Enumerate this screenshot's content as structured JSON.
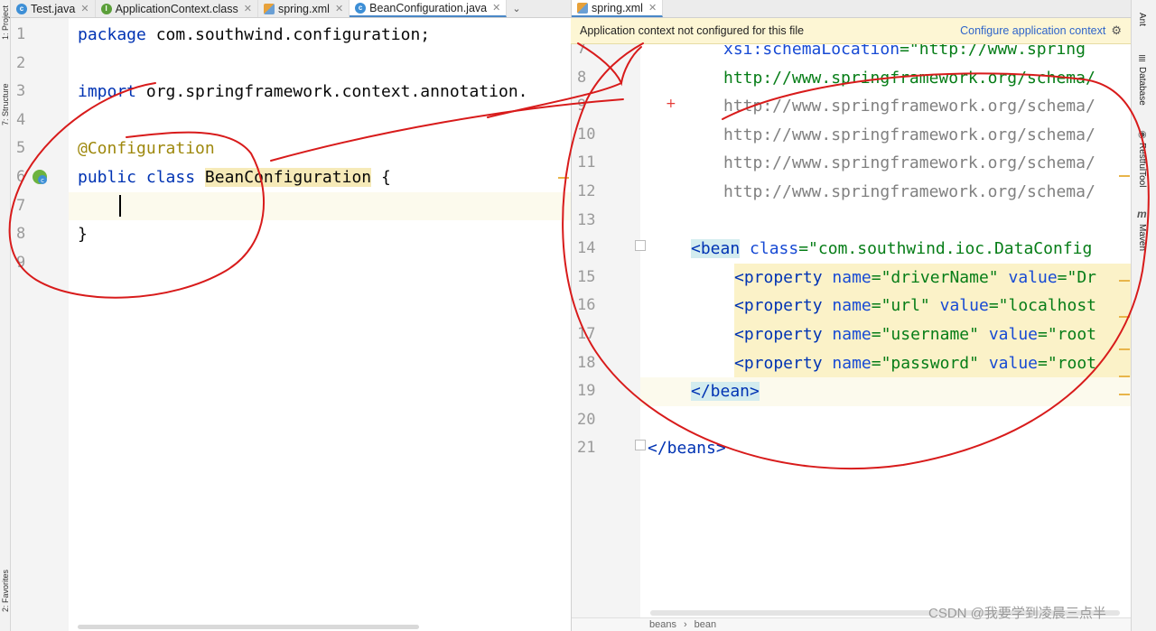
{
  "left_tabs": [
    {
      "icon": "java-class-icon",
      "label": "Test.java"
    },
    {
      "icon": "interface-class-icon",
      "label": "ApplicationContext.class"
    },
    {
      "icon": "xml-file-icon",
      "label": "spring.xml"
    },
    {
      "icon": "java-class-icon",
      "label": "BeanConfiguration.java",
      "active": true
    }
  ],
  "right_tabs": [
    {
      "icon": "xml-file-icon",
      "label": "spring.xml",
      "active": true
    }
  ],
  "left_stripe": {
    "project": "1: Project",
    "structure": "7: Structure",
    "favorites": "2: Favorites"
  },
  "right_stripe": {
    "ant": "Ant",
    "database": "Database",
    "restful": "RestfulTool",
    "maven": "Maven"
  },
  "banner": {
    "message": "Application context not configured for this file",
    "action": "Configure application context"
  },
  "left_editor": {
    "line_numbers": [
      "1",
      "2",
      "3",
      "4",
      "5",
      "6",
      "7",
      "8",
      "9"
    ],
    "line1": {
      "kw": "package",
      "rest": " com.southwind.configuration;"
    },
    "line3": {
      "kw": "import",
      "rest": " org.springframework.context.annotation."
    },
    "line5": {
      "ann": "@Configuration"
    },
    "line6": {
      "kw": "public class",
      "cls": "BeanConfiguration",
      "rest": " {"
    },
    "line8": {
      "text": "}"
    }
  },
  "right_editor": {
    "line_numbers": [
      "7",
      "8",
      "9",
      "10",
      "11",
      "12",
      "13",
      "14",
      "15",
      "16",
      "17",
      "18",
      "19",
      "20",
      "21"
    ],
    "line7": {
      "attr": "xsi:schemaLocation",
      "str": "=\"http://www.spring"
    },
    "line8": "http://www.springframework.org/schema/",
    "line9": "http://www.springframework.org/schema/",
    "line10": "http://www.springframework.org/schema/",
    "line11": "http://www.springframework.org/schema/",
    "line12": "http://www.springframework.org/schema/",
    "line14": {
      "tag": "<bean",
      "attr": "class",
      "str": "=\"com.southwind.ioc.DataConfig"
    },
    "line15": {
      "tag": "<property",
      "a1": "name",
      "s1": "=\"driverName\"",
      "a2": "value",
      "s2": "=\"Dr"
    },
    "line16": {
      "tag": "<property",
      "a1": "name",
      "s1": "=\"url\"",
      "a2": "value",
      "s2": "=\"localhost"
    },
    "line17": {
      "tag": "<property",
      "a1": "name",
      "s1": "=\"username\"",
      "a2": "value",
      "s2": "=\"root"
    },
    "line18": {
      "tag": "<property",
      "a1": "name",
      "s1": "=\"password\"",
      "a2": "value",
      "s2": "=\"root"
    },
    "line19": {
      "tag": "</bean>"
    },
    "line21": {
      "tag": "</beans>"
    }
  },
  "breadcrumb": [
    "beans",
    "bean"
  ],
  "watermark": "CSDN @我要学到凌晨三点半"
}
